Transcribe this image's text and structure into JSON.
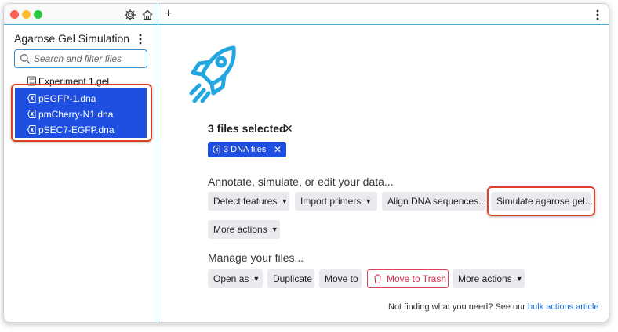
{
  "sidebar": {
    "title": "Agarose Gel Simulation",
    "search_placeholder": "Search and filter files",
    "files": [
      {
        "name": "Experiment 1.gel",
        "icon": "gel-file-icon",
        "selected": false
      },
      {
        "name": "pEGFP-1.dna",
        "icon": "dna-file-icon",
        "selected": true
      },
      {
        "name": "pmCherry-N1.dna",
        "icon": "dna-file-icon",
        "selected": true
      },
      {
        "name": "pSEC7-EGFP.dna",
        "icon": "dna-file-icon",
        "selected": true
      }
    ]
  },
  "main": {
    "selection_title": "3 files selected",
    "selection_tag": "3 DNA files",
    "annotate_label": "Annotate, simulate, or edit your data...",
    "annotate_actions": {
      "detect": "Detect features",
      "import": "Import primers",
      "align": "Align DNA sequences...",
      "simulate": "Simulate agarose gel...",
      "more": "More actions"
    },
    "manage_label": "Manage your files...",
    "manage_actions": {
      "open": "Open as",
      "duplicate": "Duplicate",
      "move": "Move to",
      "trash": "Move to Trash",
      "more": "More actions"
    },
    "footer_text": "Not finding what you need? See our ",
    "footer_link": "bulk actions article"
  },
  "colors": {
    "accent": "#1f4fe0",
    "highlight": "#e0402a",
    "divider": "#46a9d8",
    "rocket": "#22a7e0",
    "danger": "#d32f4a"
  }
}
